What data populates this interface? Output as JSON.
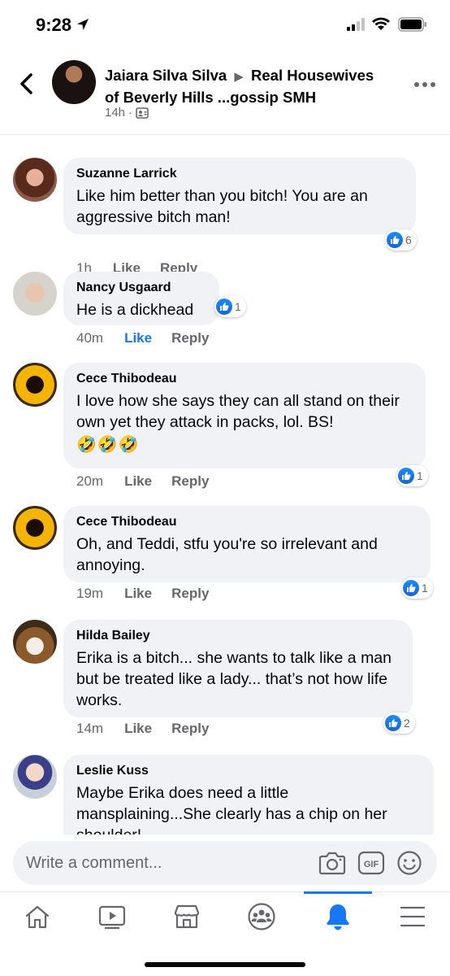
{
  "status_bar": {
    "time": "9:28"
  },
  "header": {
    "author": "Jaiara Silva Silva",
    "group": "Real Housewives of Beverly Hills ...gossip SMH",
    "time": "14h",
    "separator": "·"
  },
  "cut_off_actions": "1h  Like  Reply",
  "comments": [
    {
      "name": "Suzanne Larrick",
      "text": "Like him better than you bitch! You are an aggressive bitch man!",
      "time": "1h",
      "like_label": "Like",
      "reply_label": "Reply",
      "reactions": "6",
      "liked": false
    },
    {
      "name": "Nancy Usgaard",
      "text": "He is a dickhead",
      "time": "40m",
      "like_label": "Like",
      "reply_label": "Reply",
      "reactions": "1",
      "liked": true
    },
    {
      "name": "Cece Thibodeau",
      "text": "I love how she says they can all stand on their own yet they attack in packs,  lol.  BS!",
      "emoji": "🤣🤣🤣",
      "time": "20m",
      "like_label": "Like",
      "reply_label": "Reply",
      "reactions": "1",
      "liked": false
    },
    {
      "name": "Cece Thibodeau",
      "text": "Oh, and Teddi,  stfu you're so irrelevant and annoying.",
      "time": "19m",
      "like_label": "Like",
      "reply_label": "Reply",
      "reactions": "1",
      "liked": false
    },
    {
      "name": "Hilda Bailey",
      "text": "Erika is a bitch... she wants to talk like a man but be treated like a lady... that’s not how life works.",
      "time": "14m",
      "like_label": "Like",
      "reply_label": "Reply",
      "reactions": "2",
      "liked": false
    },
    {
      "name": "Leslie Kuss",
      "text": "Maybe Erika does need a little mansplaining...She clearly has a chip on her shoulder!",
      "liked": false
    }
  ],
  "composer": {
    "placeholder": "Write a comment..."
  },
  "colors": {
    "accent": "#1877f2",
    "bubble": "#f0f2f5",
    "secondary_text": "#65676b"
  },
  "icons": {
    "back": "chevron-left-icon",
    "more": "more-horizontal-icon",
    "camera": "camera-icon",
    "gif": "gif-icon",
    "emoji": "smiley-icon"
  },
  "nav": [
    "home-icon",
    "watch-icon",
    "marketplace-icon",
    "groups-icon",
    "notifications-icon",
    "menu-icon"
  ]
}
